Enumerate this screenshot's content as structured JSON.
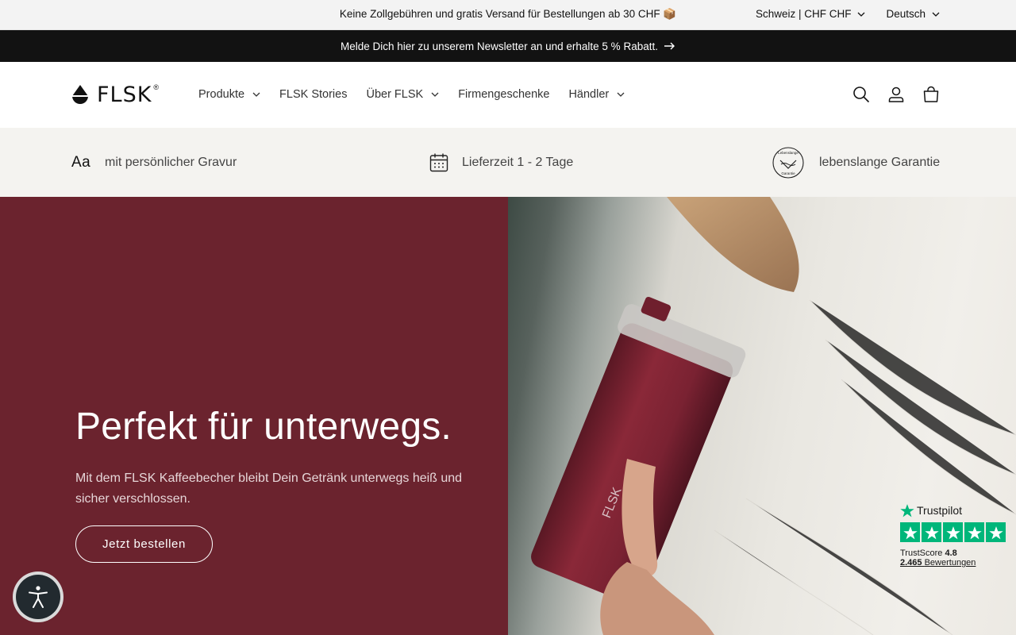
{
  "announcement": {
    "text": "Keine Zollgebühren und gratis Versand für Bestellungen ab 30 CHF 📦"
  },
  "localization": {
    "country": "Schweiz | CHF CHF",
    "language": "Deutsch"
  },
  "newsletter": {
    "text": "Melde Dich hier zu unserem Newsletter an und erhalte 5 % Rabatt."
  },
  "header": {
    "logo_text": "FLSK",
    "logo_reg": "®",
    "nav": [
      {
        "label": "Produkte",
        "dropdown": true
      },
      {
        "label": "FLSK Stories",
        "dropdown": false
      },
      {
        "label": "Über FLSK",
        "dropdown": true
      },
      {
        "label": "Firmengeschenke",
        "dropdown": false
      },
      {
        "label": "Händler",
        "dropdown": true
      }
    ],
    "icons": [
      "search-icon",
      "account-icon",
      "cart-icon"
    ]
  },
  "usp": {
    "engraving_glyph": "Aa",
    "engraving": "mit persönlicher Gravur",
    "delivery": "Lieferzeit 1 - 2 Tage",
    "guarantee": "lebenslange Garantie",
    "seal_top": "Lebenslange",
    "seal_bottom": "Garantie"
  },
  "hero": {
    "title": "Perfekt für unterwegs.",
    "subtitle": "Mit dem FLSK Kaffeebecher bleibt Dein Getränk unterwegs heiß und sicher verschlossen.",
    "cta": "Jetzt bestellen",
    "cup_logo": "FLSK"
  },
  "trustpilot": {
    "brand": "Trustpilot",
    "score_label": "TrustScore",
    "score": "4.8",
    "reviews_count": "2.465",
    "reviews_label": "Bewertungen"
  },
  "colors": {
    "hero_bg": "#6b232e",
    "trustpilot_green": "#00b67a",
    "newsletter_bg": "#121212",
    "usp_bg": "#f4f3f0"
  }
}
